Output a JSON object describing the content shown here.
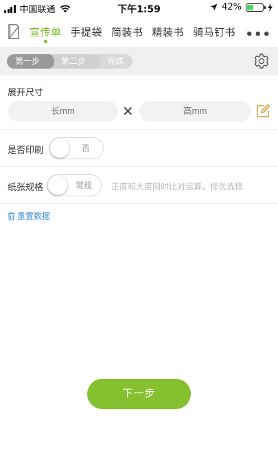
{
  "status_bar": {
    "carrier": "中国联通",
    "time": "下午1:59",
    "battery": "42%"
  },
  "nav": {
    "tabs": [
      {
        "label": "宣传单",
        "active": true
      },
      {
        "label": "手提袋",
        "active": false
      },
      {
        "label": "简装书",
        "active": false
      },
      {
        "label": "精装书",
        "active": false
      },
      {
        "label": "骑马钉书",
        "active": false
      }
    ],
    "more_label": "•••"
  },
  "steps": [
    "第一步",
    "第二步",
    "完成"
  ],
  "size_section": {
    "label": "展开尺寸",
    "length_placeholder": "长mm",
    "height_placeholder": "高mm",
    "times": "✕"
  },
  "print_section": {
    "label": "是否印刷",
    "toggle_value": "否"
  },
  "paper_section": {
    "label": "纸张规格",
    "toggle_value": "常规",
    "hint": "正度和大度同时比对运算，择优选择"
  },
  "reset_label": "重置数据",
  "next_label": "下一步",
  "colors": {
    "accent": "#85c02f",
    "link": "#3d8fd6"
  }
}
